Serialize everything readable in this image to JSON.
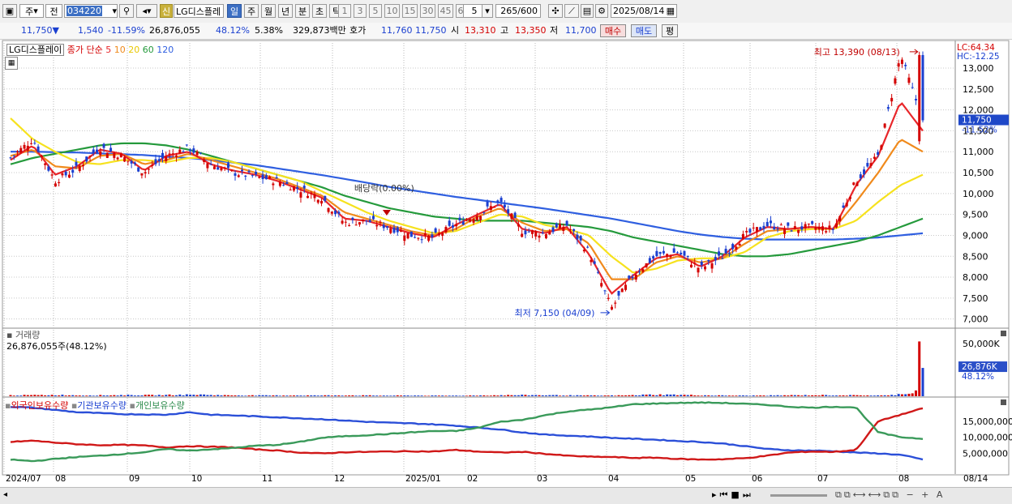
{
  "toolbar": {
    "period_main": "주",
    "jeon": "전",
    "code": "034220",
    "sin": "신",
    "stock_name": "LG디스플레",
    "tabs": [
      "일",
      "주",
      "월",
      "년",
      "분",
      "초",
      "틱"
    ],
    "active_tab": "일",
    "nums": [
      "1",
      "3",
      "5",
      "10",
      "15",
      "30",
      "45",
      "60"
    ],
    "dropdown_val": "5",
    "count": "265",
    "count_total": "/600",
    "date": "2025/08/14"
  },
  "quote": {
    "price": "11,750",
    "arrow": "▼",
    "change": "1,540",
    "change_pct": "-11.59%",
    "volume": "26,876,055",
    "vol_pct": "48.12%",
    "turnover": "5.38%",
    "amount": "329,873백만",
    "hoga_label": "호가",
    "ask": "11,760",
    "bid": "11,750",
    "open_label": "시",
    "open": "13,310",
    "high_label": "고",
    "high": "13,350",
    "low_label": "저",
    "low": "11,700",
    "buy": "매수",
    "sell": "매도",
    "eval": "평"
  },
  "price_panel": {
    "name": "LG디스플레이",
    "ma_label": "종가 단순",
    "ma_periods": [
      "5",
      "10",
      "20",
      "60",
      "120"
    ],
    "lc": "LC:64.34",
    "hc": "HC:-12.25",
    "hi_label": "최고 13,390 (08/13)",
    "lo_label": "최저 7,150 (04/09)",
    "div_label": "배당락(0.00%)",
    "cur_price": "11,750",
    "cur_pct": "-11.52%"
  },
  "volume_panel": {
    "title": "거래량",
    "value": "26,876,055주(48.12%)",
    "cur": "26,876K",
    "cur_pct": "48.12%"
  },
  "holdings_panel": {
    "series": [
      "외국인보유수량",
      "기관보유수량",
      "개인보유수량"
    ]
  },
  "colors": {
    "up": "#d40000",
    "down": "#1a3fd0",
    "ma5": "#e8262a",
    "ma10": "#f08a1c",
    "ma20": "#f6e21e",
    "ma60": "#259a3c",
    "ma120": "#2f5fe0",
    "foreign": "#2b4fd8",
    "inst": "#d01818",
    "indiv": "#3a9a5a"
  },
  "chart_data": [
    {
      "type": "candlestick",
      "title": "LG디스플레이",
      "ylim": [
        6800,
        13600
      ],
      "y_ticks": [
        "13,000",
        "12,500",
        "12,000",
        "11,500",
        "11,000",
        "10,500",
        "10,000",
        "9,500",
        "9,000",
        "8,500",
        "8,000",
        "7,500",
        "7,000"
      ],
      "x_ticks": [
        "2024/07",
        "08",
        "09",
        "10",
        "11",
        "12",
        "2025/01",
        "02",
        "03",
        "04",
        "05",
        "06",
        "07",
        "08",
        "08/14"
      ],
      "close_anchors": [
        {
          "x": "2024/07",
          "y": 10850
        },
        {
          "x": "07 mid",
          "y": 11300
        },
        {
          "x": "08 early",
          "y": 10300
        },
        {
          "x": "08 mid",
          "y": 10600
        },
        {
          "x": "08 late",
          "y": 11100
        },
        {
          "x": "09 early",
          "y": 10900
        },
        {
          "x": "09 mid",
          "y": 10500
        },
        {
          "x": "09 late",
          "y": 10900
        },
        {
          "x": "10 early",
          "y": 11100
        },
        {
          "x": "10 mid",
          "y": 10700
        },
        {
          "x": "10 late",
          "y": 10500
        },
        {
          "x": "11 early",
          "y": 10400
        },
        {
          "x": "11 mid",
          "y": 10300
        },
        {
          "x": "11 late",
          "y": 10100
        },
        {
          "x": "12 early",
          "y": 9900
        },
        {
          "x": "12 mid",
          "y": 9300
        },
        {
          "x": "12 late",
          "y": 9350
        },
        {
          "x": "2025/01 early",
          "y": 9200
        },
        {
          "x": "01 mid",
          "y": 9000
        },
        {
          "x": "01 late",
          "y": 8950
        },
        {
          "x": "02 early",
          "y": 9250
        },
        {
          "x": "02 mid",
          "y": 9500
        },
        {
          "x": "02 late",
          "y": 9800
        },
        {
          "x": "03 early",
          "y": 9100
        },
        {
          "x": "03 mid",
          "y": 9050
        },
        {
          "x": "03 late",
          "y": 9250
        },
        {
          "x": "04 early",
          "y": 8600
        },
        {
          "x": "04/09",
          "y": 7250
        },
        {
          "x": "04 late",
          "y": 8050
        },
        {
          "x": "05 early",
          "y": 8500
        },
        {
          "x": "05 mid",
          "y": 8600
        },
        {
          "x": "05 late",
          "y": 8200
        },
        {
          "x": "06 early",
          "y": 8500
        },
        {
          "x": "06 mid",
          "y": 9000
        },
        {
          "x": "06 late",
          "y": 9250
        },
        {
          "x": "07 early",
          "y": 9150
        },
        {
          "x": "07 mid",
          "y": 9200
        },
        {
          "x": "07 late",
          "y": 9150
        },
        {
          "x": "08 early",
          "y": 10300
        },
        {
          "x": "08 mid",
          "y": 10900
        },
        {
          "x": "08/13",
          "y": 13310
        },
        {
          "x": "08/14",
          "y": 11750
        }
      ],
      "high": {
        "value": 13390,
        "date": "08/13"
      },
      "low": {
        "value": 7150,
        "date": "04/09"
      },
      "last": 11750,
      "series": [
        {
          "name": "5",
          "values": [
            10800,
            11150,
            10450,
            10650,
            11050,
            10950,
            10550,
            10900,
            11000,
            10700,
            10550,
            10450,
            10300,
            10100,
            9900,
            9400,
            9350,
            9200,
            9050,
            8950,
            9250,
            9500,
            9750,
            9150,
            9050,
            9200,
            8550,
            7600,
            8050,
            8450,
            8550,
            8250,
            8500,
            8950,
            9200,
            9150,
            9200,
            9150,
            10200,
            10900,
            12200,
            11500
          ]
        },
        {
          "name": "10",
          "values": [
            10900,
            11050,
            10650,
            10600,
            10900,
            10950,
            10700,
            10800,
            10950,
            10800,
            10650,
            10500,
            10350,
            10150,
            9950,
            9550,
            9400,
            9250,
            9100,
            9000,
            9150,
            9450,
            9650,
            9300,
            9100,
            9150,
            8800,
            7950,
            7950,
            8350,
            8500,
            8350,
            8450,
            8800,
            9100,
            9150,
            9200,
            9150,
            9800,
            10500,
            11300,
            11000
          ]
        },
        {
          "name": "20",
          "values": [
            11800,
            11300,
            11000,
            10750,
            10700,
            10800,
            10800,
            10750,
            10850,
            10850,
            10750,
            10600,
            10450,
            10300,
            10050,
            9800,
            9550,
            9350,
            9200,
            9050,
            9100,
            9300,
            9500,
            9450,
            9250,
            9150,
            9000,
            8500,
            8100,
            8200,
            8400,
            8450,
            8450,
            8600,
            8950,
            9100,
            9150,
            9150,
            9350,
            9800,
            10200,
            10450
          ]
        },
        {
          "name": "60",
          "values": [
            10700,
            10850,
            10950,
            11050,
            11150,
            11200,
            11200,
            11150,
            11050,
            10900,
            10750,
            10600,
            10450,
            10300,
            10150,
            9950,
            9800,
            9650,
            9550,
            9450,
            9400,
            9350,
            9350,
            9350,
            9300,
            9250,
            9200,
            9100,
            8950,
            8850,
            8750,
            8650,
            8550,
            8500,
            8500,
            8550,
            8650,
            8750,
            8850,
            9000,
            9200,
            9400
          ]
        },
        {
          "name": "120",
          "values": [
            11000,
            11000,
            10990,
            10980,
            10960,
            10940,
            10920,
            10880,
            10850,
            10800,
            10740,
            10680,
            10600,
            10520,
            10440,
            10350,
            10260,
            10160,
            10080,
            10000,
            9920,
            9850,
            9780,
            9710,
            9640,
            9560,
            9480,
            9400,
            9300,
            9200,
            9100,
            9020,
            8960,
            8920,
            8900,
            8900,
            8900,
            8900,
            8920,
            8950,
            9000,
            9050
          ]
        }
      ]
    },
    {
      "type": "bar",
      "title": "거래량",
      "y_ticks": [
        "50,000K",
        "25,000K"
      ],
      "ylim": [
        0,
        60000
      ],
      "values_k": [
        900,
        1000,
        1200,
        800,
        900,
        1100,
        1000,
        1300,
        1500,
        900,
        800,
        700,
        800,
        700,
        900,
        700,
        600,
        700,
        500,
        600,
        800,
        1000,
        1100,
        900,
        700,
        600,
        800,
        1500,
        1400,
        900,
        700,
        600,
        700,
        900,
        1000,
        900,
        800,
        700,
        3500,
        5500,
        52000,
        26876
      ]
    },
    {
      "type": "line",
      "title": "",
      "y_ticks": [
        "15,000,000",
        "10,000,000",
        "5,000,000"
      ],
      "ylim": [
        0,
        20000000
      ],
      "series": [
        {
          "name": "외국인보유수량",
          "values": [
            19500000,
            19200000,
            18500000,
            17800000,
            17500000,
            17200000,
            17100000,
            17000000,
            17800000,
            17000000,
            16800000,
            16500000,
            16200000,
            15900000,
            15600000,
            15200000,
            14800000,
            14500000,
            14300000,
            14000000,
            13600000,
            13000000,
            12400000,
            11500000,
            10800000,
            10500000,
            10200000,
            9800000,
            9500000,
            9200000,
            8800000,
            8500000,
            8000000,
            7200000,
            6300000,
            5900000,
            5800000,
            5600000,
            5200000,
            4900000,
            4500000,
            3000000
          ]
        },
        {
          "name": "기관보유수량",
          "values": [
            8500000,
            8900000,
            8300000,
            7800000,
            7500000,
            7600000,
            7400000,
            6800000,
            7200000,
            7000000,
            6800000,
            6200000,
            5800000,
            5200000,
            4900000,
            5300000,
            5400000,
            5500000,
            5600000,
            5500000,
            6000000,
            5500000,
            5200000,
            5400000,
            4800000,
            4200000,
            3900000,
            3800000,
            3500000,
            3600000,
            3200000,
            3000000,
            3100000,
            3400000,
            4200000,
            5200000,
            5500000,
            5400000,
            6000000,
            15000000,
            17000000,
            19000000
          ]
        },
        {
          "name": "개인보유수량",
          "values": [
            3000000,
            2500000,
            3200000,
            3800000,
            4200000,
            4700000,
            5300000,
            6300000,
            5800000,
            6200000,
            6600000,
            7300000,
            7600000,
            8500000,
            9800000,
            10300000,
            10600000,
            11000000,
            11500000,
            11900000,
            11900000,
            12900000,
            14800000,
            15400000,
            16800000,
            18000000,
            18600000,
            19300000,
            20300000,
            20500000,
            20700000,
            20800000,
            20700000,
            20400000,
            20100000,
            19500000,
            19200000,
            19500000,
            19300000,
            11500000,
            10000000,
            9500000
          ]
        }
      ]
    }
  ]
}
